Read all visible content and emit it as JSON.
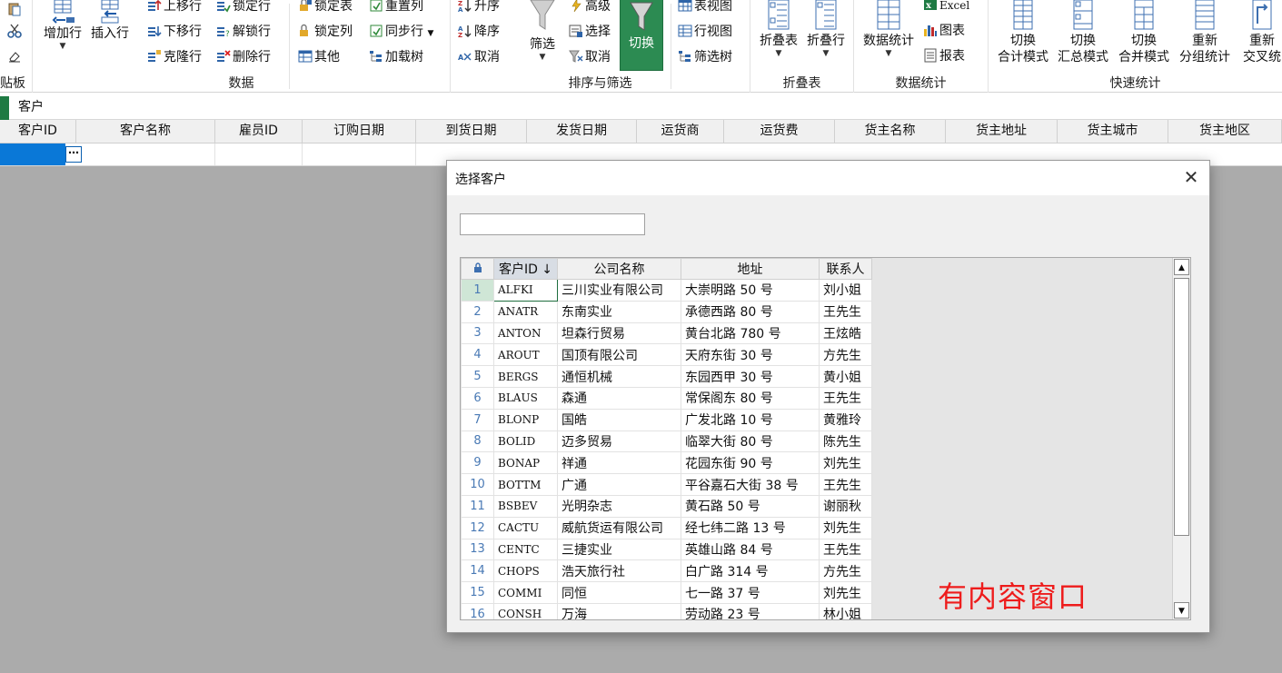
{
  "ribbon": {
    "clipboard": {
      "label": "贴板"
    },
    "data": {
      "label": "数据",
      "add_row": "增加行",
      "insert_row": "插入行",
      "move_up": "上移行",
      "move_down": "下移行",
      "clone_row": "克隆行",
      "lock_row": "锁定行",
      "unlock_row": "解锁行",
      "delete_row": "删除行",
      "lock_table": "锁定表",
      "lock_column": "锁定列",
      "other": "其他",
      "reset_column": "重置列",
      "sync_row": "同步行",
      "load_tree": "加载树"
    },
    "sort_filter": {
      "label": "排序与筛选",
      "asc": "升序",
      "desc": "降序",
      "cancel_sort": "取消",
      "filter": "筛选",
      "advanced": "高级",
      "select": "选择",
      "cancel_filter": "取消",
      "toggle": "切换",
      "table_view": "表视图",
      "row_view": "行视图",
      "filter_tree": "筛选树"
    },
    "fold": {
      "label": "折叠表",
      "fold_table": "折叠表",
      "fold_row": "折叠行"
    },
    "stats": {
      "label": "数据统计",
      "data_stats": "数据统计",
      "excel": "Excel",
      "chart": "图表",
      "report": "报表"
    },
    "quick": {
      "label": "快速统计",
      "b1_line1": "切换",
      "b1_line2": "合计模式",
      "b2_line1": "切换",
      "b2_line2": "汇总模式",
      "b3_line1": "切换",
      "b3_line2": "合并模式",
      "b4_line1": "重新",
      "b4_line2": "分组统计",
      "b5_line1": "重新",
      "b5_line2": "交叉统"
    }
  },
  "tab": {
    "name": "客户"
  },
  "columns": [
    "客户ID",
    "客户名称",
    "雇员ID",
    "订购日期",
    "到货日期",
    "发货日期",
    "运货商",
    "运货费",
    "货主名称",
    "货主地址",
    "货主城市",
    "货主地区"
  ],
  "row": {
    "ellipsis": "⋯"
  },
  "dialog": {
    "title": "选择客户",
    "close": "✕",
    "search_value": "",
    "overlay_text": "有内容窗口",
    "grid": {
      "lock_symbol": "🔒",
      "headers": [
        "客户ID ↓",
        "公司名称",
        "地址",
        "联系人"
      ],
      "rows": [
        [
          "1",
          "ALFKI",
          "三川实业有限公司",
          "大崇明路 50 号",
          "刘小姐"
        ],
        [
          "2",
          "ANATR",
          "东南实业",
          "承德西路 80 号",
          "王先生"
        ],
        [
          "3",
          "ANTON",
          "坦森行贸易",
          "黄台北路 780 号",
          "王炫皓"
        ],
        [
          "4",
          "AROUT",
          "国顶有限公司",
          "天府东街 30 号",
          "方先生"
        ],
        [
          "5",
          "BERGS",
          "通恒机械",
          "东园西甲 30 号",
          "黄小姐"
        ],
        [
          "6",
          "BLAUS",
          "森通",
          "常保阁东 80 号",
          "王先生"
        ],
        [
          "7",
          "BLONP",
          "国皓",
          "广发北路 10 号",
          "黄雅玲"
        ],
        [
          "8",
          "BOLID",
          "迈多贸易",
          "临翠大街 80 号",
          "陈先生"
        ],
        [
          "9",
          "BONAP",
          "祥通",
          "花园东街 90 号",
          "刘先生"
        ],
        [
          "10",
          "BOTTM",
          "广通",
          "平谷嘉石大街 38 号",
          "王先生"
        ],
        [
          "11",
          "BSBEV",
          "光明杂志",
          "黄石路 50 号",
          "谢丽秋"
        ],
        [
          "12",
          "CACTU",
          "威航货运有限公司",
          "经七纬二路 13 号",
          "刘先生"
        ],
        [
          "13",
          "CENTC",
          "三捷实业",
          "英雄山路 84 号",
          "王先生"
        ],
        [
          "14",
          "CHOPS",
          "浩天旅行社",
          "白广路 314 号",
          "方先生"
        ],
        [
          "15",
          "COMMI",
          "同恒",
          "七一路 37 号",
          "刘先生"
        ],
        [
          "16",
          "CONSH",
          "万海",
          "劳动路 23 号",
          "林小姐"
        ]
      ]
    }
  }
}
